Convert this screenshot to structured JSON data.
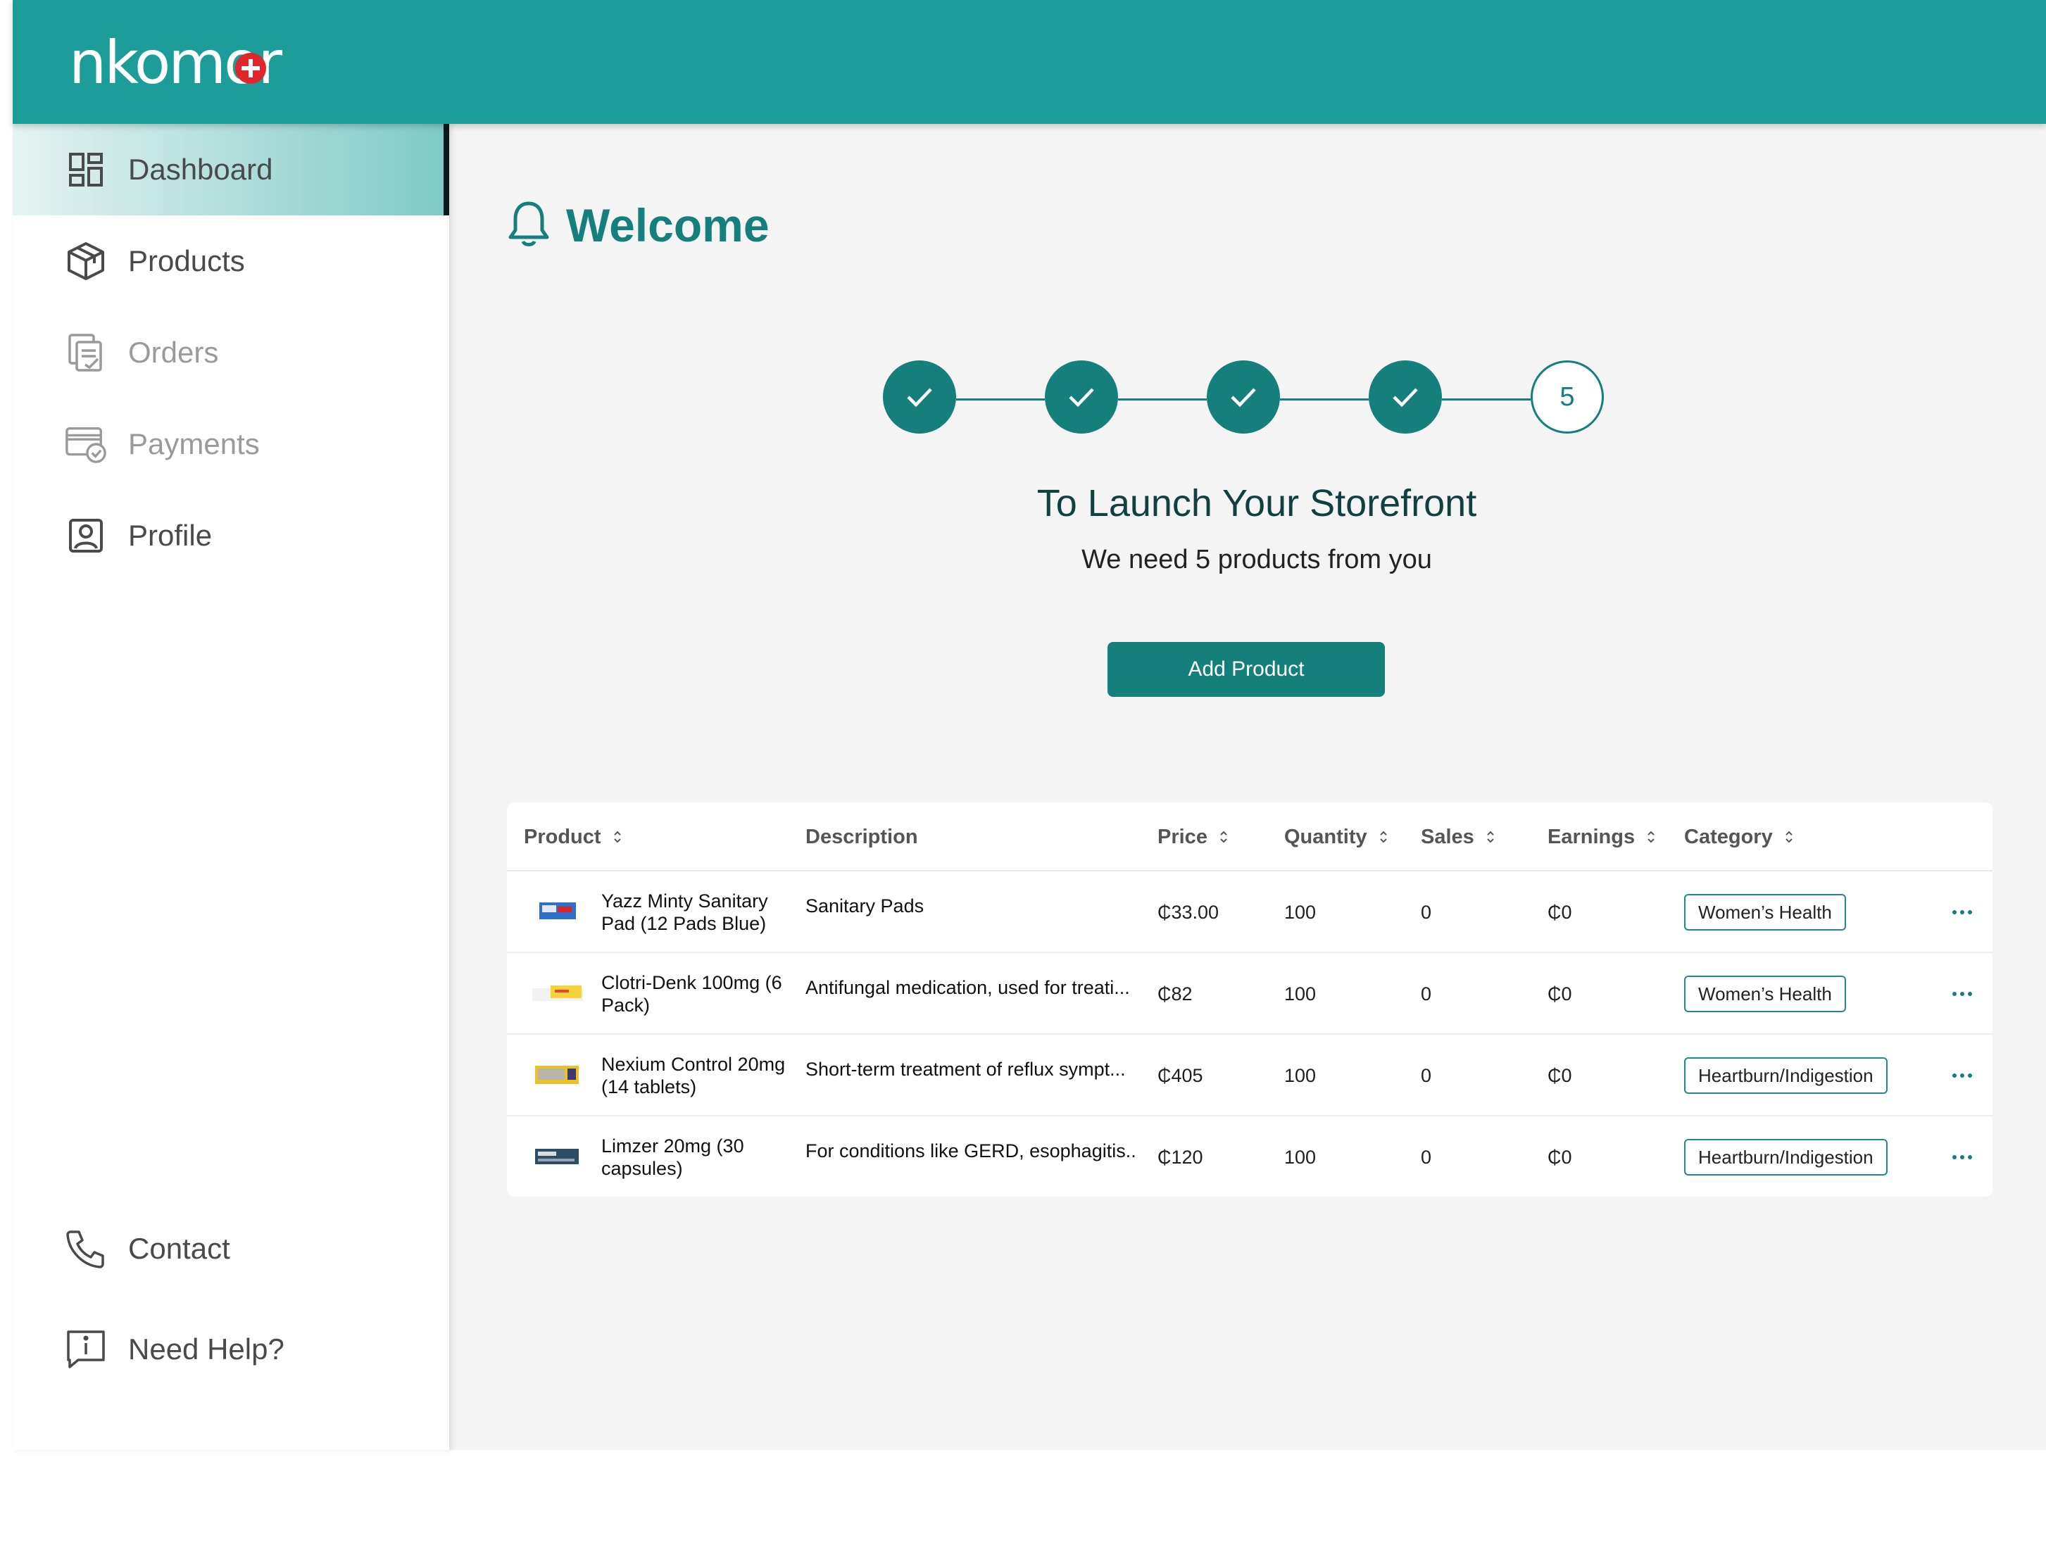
{
  "brand": {
    "logo_pre": "nkom",
    "logo_o": "o",
    "logo_post": "r"
  },
  "colors": {
    "primary": "#1c9d9a",
    "accent": "#157f7b",
    "logo_dot": "#e0252b"
  },
  "sidebar": {
    "items": [
      {
        "label": "Dashboard",
        "icon": "dashboard-icon"
      },
      {
        "label": "Products",
        "icon": "box-icon"
      },
      {
        "label": "Orders",
        "icon": "orders-icon"
      },
      {
        "label": "Payments",
        "icon": "payments-icon"
      },
      {
        "label": "Profile",
        "icon": "profile-icon"
      }
    ],
    "footer": [
      {
        "label": "Contact",
        "icon": "phone-icon"
      },
      {
        "label": "Need Help?",
        "icon": "help-icon"
      }
    ]
  },
  "main": {
    "title": "Welcome",
    "stepper": {
      "completed_steps": 4,
      "total_steps": 5,
      "current_label": "5"
    },
    "launch_title": "To Launch Your Storefront",
    "launch_sub": "We need 5 products from you",
    "add_button": "Add Product"
  },
  "table": {
    "columns": [
      "Product",
      "Description",
      "Price",
      "Quantity",
      "Sales",
      "Earnings",
      "Category"
    ],
    "rows": [
      {
        "product": "Yazz Minty Sanitary Pad (12 Pads Blue)",
        "description": "Sanitary Pads",
        "price": "₵33.00",
        "quantity": "100",
        "sales": "0",
        "earnings": "₵0",
        "category": "Women’s Health"
      },
      {
        "product": "Clotri-Denk 100mg (6 Pack)",
        "description": "Antifungal medication, used for treati...",
        "price": "₵82",
        "quantity": "100",
        "sales": "0",
        "earnings": "₵0",
        "category": "Women’s Health"
      },
      {
        "product": "Nexium Control 20mg (14 tablets)",
        "description": "Short-term treatment of reflux sympt...",
        "price": "₵405",
        "quantity": "100",
        "sales": "0",
        "earnings": "₵0",
        "category": "Heartburn/Indigestion"
      },
      {
        "product": "Limzer 20mg (30 capsules)",
        "description": "For conditions like GERD, esophagitis...",
        "price": "₵120",
        "quantity": "100",
        "sales": "0",
        "earnings": "₵0",
        "category": "Heartburn/Indigestion"
      }
    ]
  }
}
